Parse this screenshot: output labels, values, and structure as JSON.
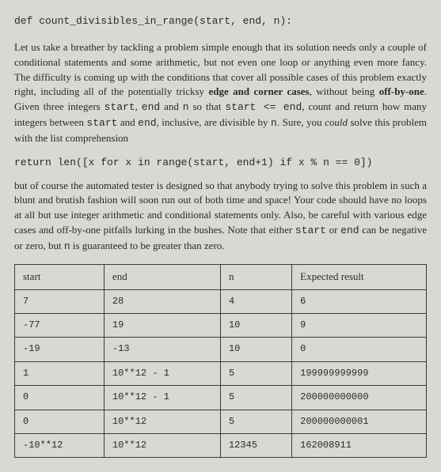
{
  "signature": "def count_divisibles_in_range(start, end, n):",
  "para1_a": "Let us take a breather by tackling a problem simple enough that its solution needs only a couple of conditional statements and some arithmetic, but not even one loop or anything even more fancy. The difficulty is coming up with the conditions that cover all possible cases of this problem exactly right, including all of the potentially tricksy ",
  "para1_b": "edge and corner cases",
  "para1_c": ", without being ",
  "para1_d": "off-by-one",
  "para1_e": ". Given three integers ",
  "code_start": "start",
  "para1_f": ", ",
  "code_end": "end",
  "para1_g": " and ",
  "code_n": "n",
  "para1_h": " so that ",
  "code_cmp": "start <= end",
  "para1_i": ", count and return how many integers between ",
  "para1_j": " and ",
  "para1_k": ", inclusive, are divisible by ",
  "para1_l": ". Sure, you ",
  "para1_m": "could",
  "para1_n": " solve this problem with the list comprehension",
  "return_line": "return len([x for x in range(start, end+1) if x % n == 0])",
  "para2_a": "but of course the automated tester is designed so that anybody trying to solve this problem in such a blunt and brutish fashion will soon run out of both time and space! Your code should have no loops at all but use integer arithmetic and conditional statements only. Also, be careful with various edge cases and off-by-one pitfalls lurking in the bushes. Note that either ",
  "para2_b": " or ",
  "para2_c": " can be negative or zero, but ",
  "para2_d": " is guaranteed to be greater than zero.",
  "table": {
    "headers": [
      "start",
      "end",
      "n",
      "Expected result"
    ],
    "rows": [
      [
        "7",
        "28",
        "4",
        "6"
      ],
      [
        "-77",
        "19",
        "10",
        "9"
      ],
      [
        "-19",
        "-13",
        "10",
        "0"
      ],
      [
        "1",
        "10**12 - 1",
        "5",
        "199999999999"
      ],
      [
        "0",
        "10**12 - 1",
        "5",
        "200000000000"
      ],
      [
        "0",
        "10**12",
        "5",
        "200000000001"
      ],
      [
        "-10**12",
        "10**12",
        "12345",
        "162008911"
      ]
    ]
  }
}
